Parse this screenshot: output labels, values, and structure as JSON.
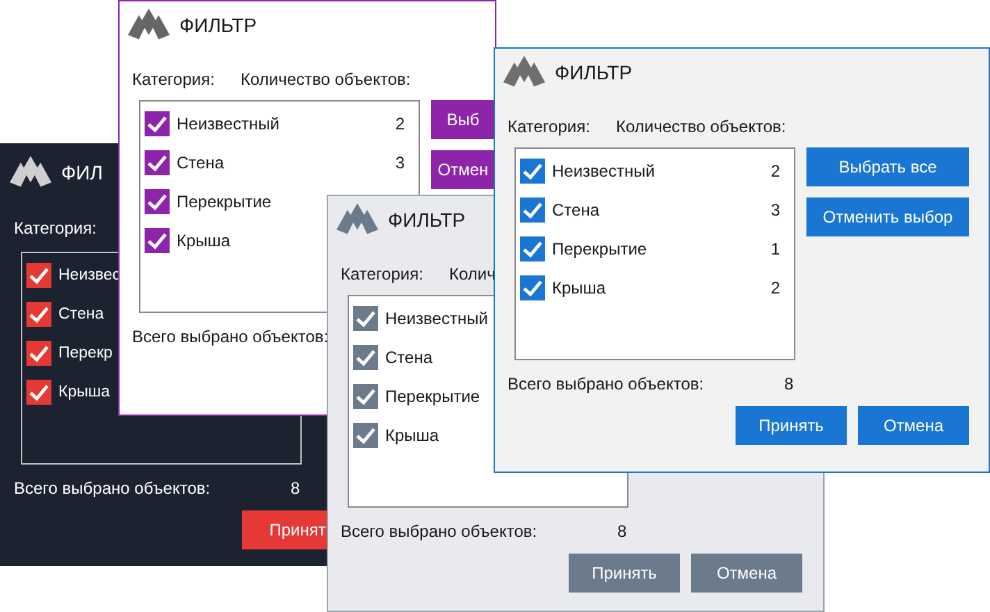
{
  "windows": [
    {
      "kind": "dark",
      "title": "ФИЛ",
      "category_label": "Категория:",
      "items": [
        {
          "label": "Неизвес",
          "checked": true
        },
        {
          "label": "Стена",
          "checked": true
        },
        {
          "label": "Перекр",
          "checked": true
        },
        {
          "label": "Крыша",
          "checked": true
        }
      ],
      "total_label": "Всего выбрано объектов:",
      "total_value": "8",
      "buttons": [
        "Принят"
      ]
    },
    {
      "kind": "purple",
      "title": "ФИЛЬТР",
      "category_label": "Категория:",
      "count_label": "Количество объектов:",
      "items": [
        {
          "label": "Неизвестный",
          "checked": true,
          "count": "2"
        },
        {
          "label": "Стена",
          "checked": true,
          "count": "3"
        },
        {
          "label": "Перекрытие",
          "checked": true
        },
        {
          "label": "Крыша",
          "checked": true
        }
      ],
      "side_buttons": [
        "Выб",
        "Отмен"
      ],
      "total_label": "Всего выбрано объектов:"
    },
    {
      "kind": "slate",
      "title": "ФИЛЬТР",
      "category_label": "Категория:",
      "count_label": "Колич",
      "items": [
        {
          "label": "Неизвестный",
          "checked": true
        },
        {
          "label": "Стена",
          "checked": true
        },
        {
          "label": "Перекрытие",
          "checked": true
        },
        {
          "label": "Крыша",
          "checked": true
        }
      ],
      "total_label": "Всего выбрано объектов:",
      "total_value": "8",
      "buttons": [
        "Принять",
        "Отмена"
      ]
    },
    {
      "kind": "blue",
      "title": "ФИЛЬТР",
      "category_label": "Категория:",
      "count_label": "Количество объектов:",
      "items": [
        {
          "label": "Неизвестный",
          "checked": true,
          "count": "2"
        },
        {
          "label": "Стена",
          "checked": true,
          "count": "3"
        },
        {
          "label": "Перекрытие",
          "checked": true,
          "count": "1"
        },
        {
          "label": "Крыша",
          "checked": true,
          "count": "2"
        }
      ],
      "side_buttons": [
        "Выбрать все",
        "Отменить выбор"
      ],
      "total_label": "Всего выбрано объектов:",
      "total_value": "8",
      "buttons": [
        "Принять",
        "Отмена"
      ]
    }
  ]
}
